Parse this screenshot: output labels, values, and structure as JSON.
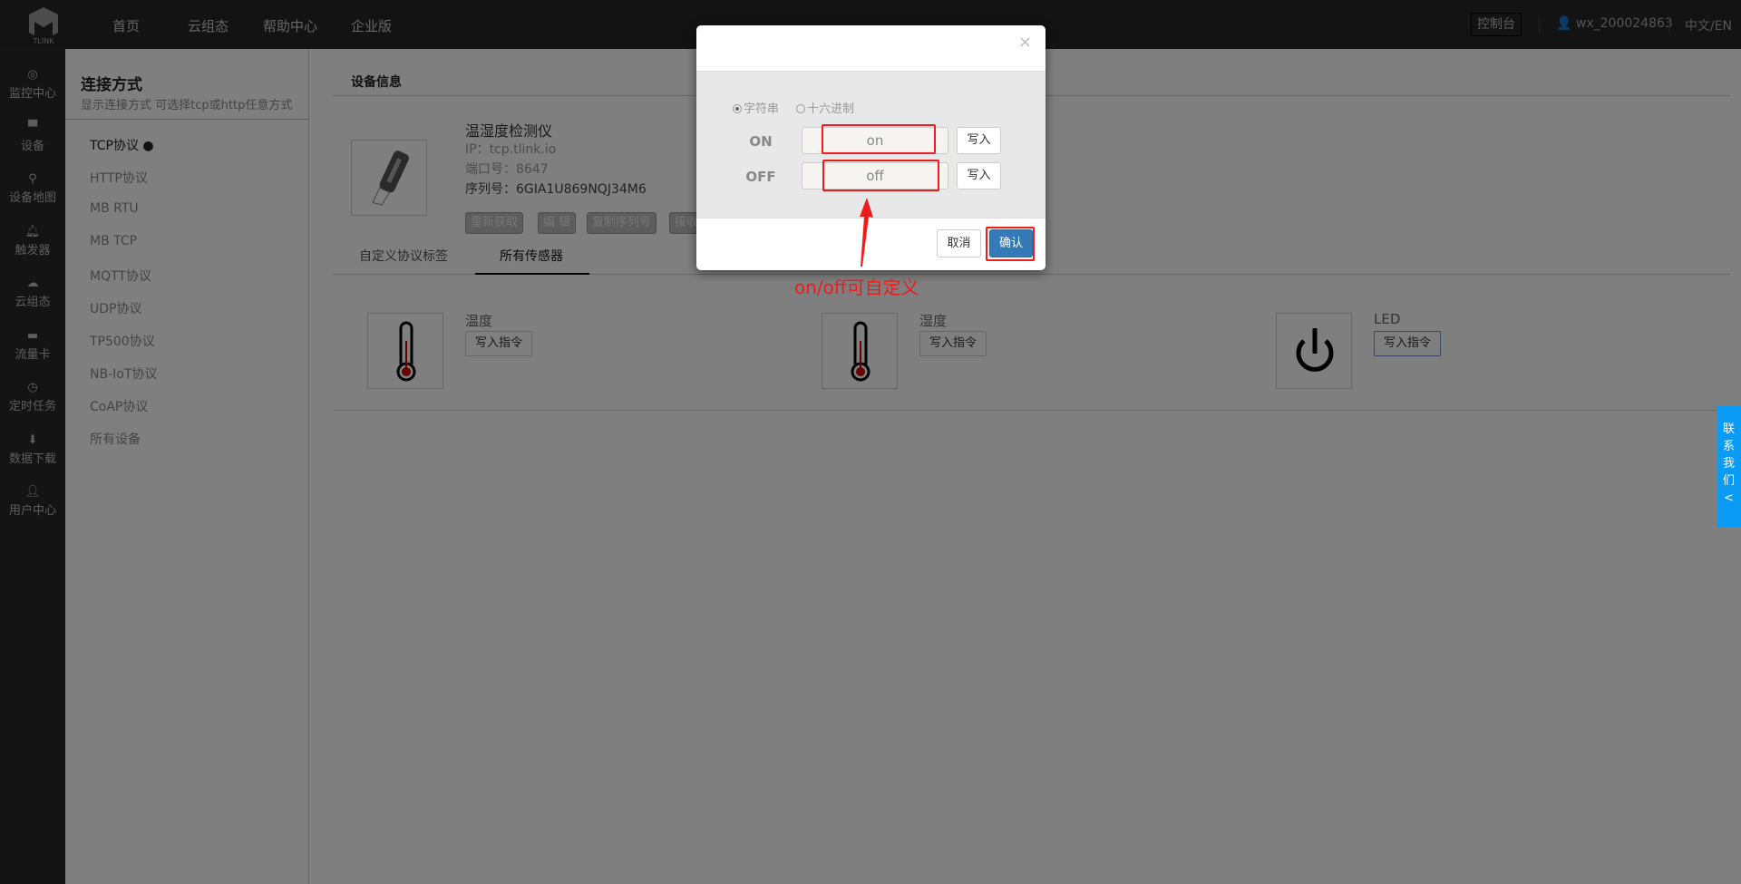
{
  "header": {
    "logo_text": "TLINK",
    "nav": [
      "首页",
      "云组态",
      "帮助中心",
      "企业版"
    ],
    "console": "控制台",
    "user": "wx_200024863",
    "lang": "中文/EN"
  },
  "leftnav": [
    {
      "icon": "target-icon",
      "label": "监控中心"
    },
    {
      "icon": "device-icon",
      "label": "设备"
    },
    {
      "icon": "map-pin-icon",
      "label": "设备地图"
    },
    {
      "icon": "bell-icon",
      "label": "触发器"
    },
    {
      "icon": "cloud-icon",
      "label": "云组态"
    },
    {
      "icon": "card-icon",
      "label": "流量卡"
    },
    {
      "icon": "clock-icon",
      "label": "定时任务"
    },
    {
      "icon": "download-icon",
      "label": "数据下载"
    },
    {
      "icon": "user-icon",
      "label": "用户中心"
    }
  ],
  "subpanel": {
    "title": "连接方式",
    "subtitle": "显示连接方式 可选择tcp或http任意方式",
    "items": [
      "TCP协议 ●",
      "HTTP协议",
      "MB RTU",
      "MB TCP",
      "MQTT协议",
      "UDP协议",
      "TP500协议",
      "NB-IoT协议",
      "CoAP协议",
      "所有设备"
    ]
  },
  "main": {
    "title": "设备信息",
    "device": {
      "name": "温湿度检测仪",
      "ip": "IP：tcp.tlink.io",
      "port": "端口号：8647",
      "serial": "序列号：6GIA1U869NQJ34M6"
    },
    "buttons": [
      "重新获取",
      "编 辑",
      "复制序列号",
      "接收"
    ],
    "tabs": [
      "自定义协议标签",
      "所有传感器"
    ],
    "sensors": [
      {
        "name": "温度",
        "icon": "thermometer-icon",
        "button": "写入指令"
      },
      {
        "name": "湿度",
        "icon": "thermometer-icon",
        "button": "写入指令"
      },
      {
        "name": "LED",
        "icon": "power-icon",
        "button": "写入指令"
      }
    ]
  },
  "contact": [
    "联",
    "系",
    "我",
    "们",
    "<"
  ],
  "modal": {
    "close": "×",
    "radio_string": "字符串",
    "radio_hex": "十六进制",
    "selected": "字符串",
    "on_label": "ON",
    "on_value": "on",
    "off_label": "OFF",
    "off_value": "off",
    "write": "写入",
    "cancel": "取消",
    "confirm": "确认"
  },
  "annotation": {
    "text": "on/off可自定义",
    "color": "#f01b1b"
  }
}
